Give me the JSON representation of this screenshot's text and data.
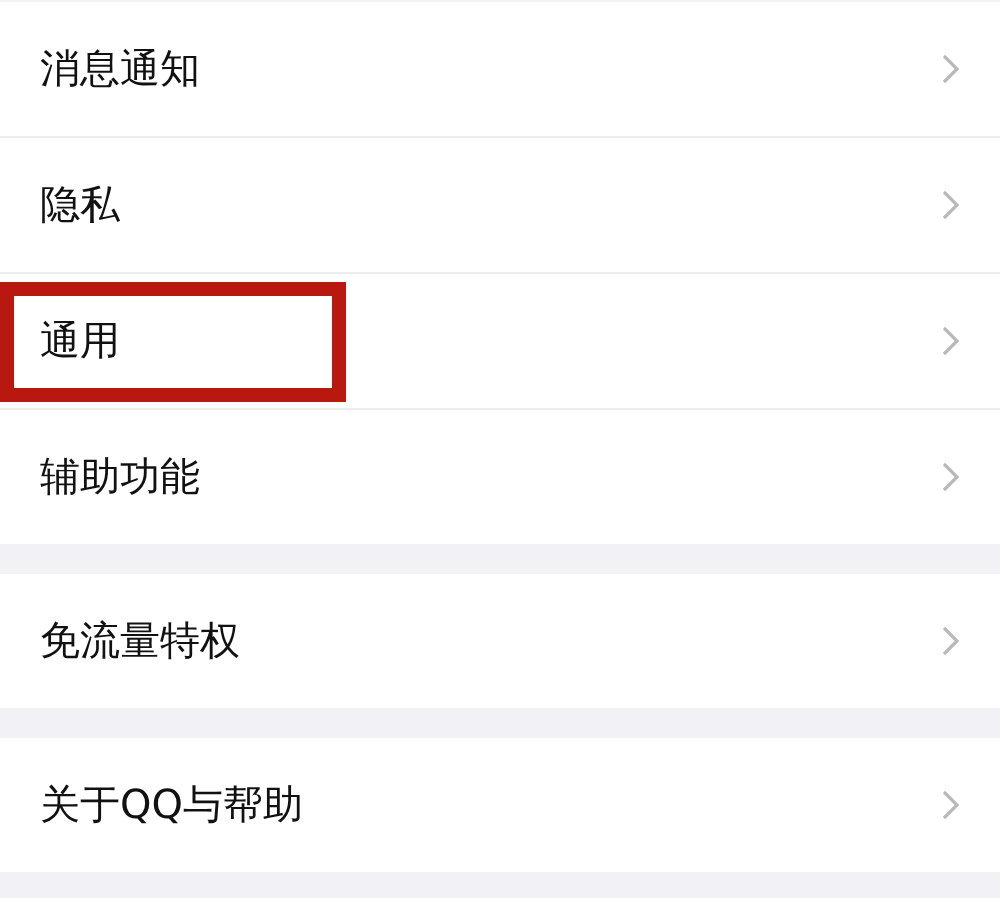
{
  "groups": [
    {
      "items": [
        {
          "label": "消息通知",
          "highlighted": false
        },
        {
          "label": "隐私",
          "highlighted": false
        },
        {
          "label": "通用",
          "highlighted": true
        },
        {
          "label": "辅助功能",
          "highlighted": false
        }
      ]
    },
    {
      "items": [
        {
          "label": "免流量特权",
          "highlighted": false
        }
      ]
    },
    {
      "items": [
        {
          "label": "关于QQ与帮助",
          "highlighted": false
        }
      ]
    }
  ]
}
